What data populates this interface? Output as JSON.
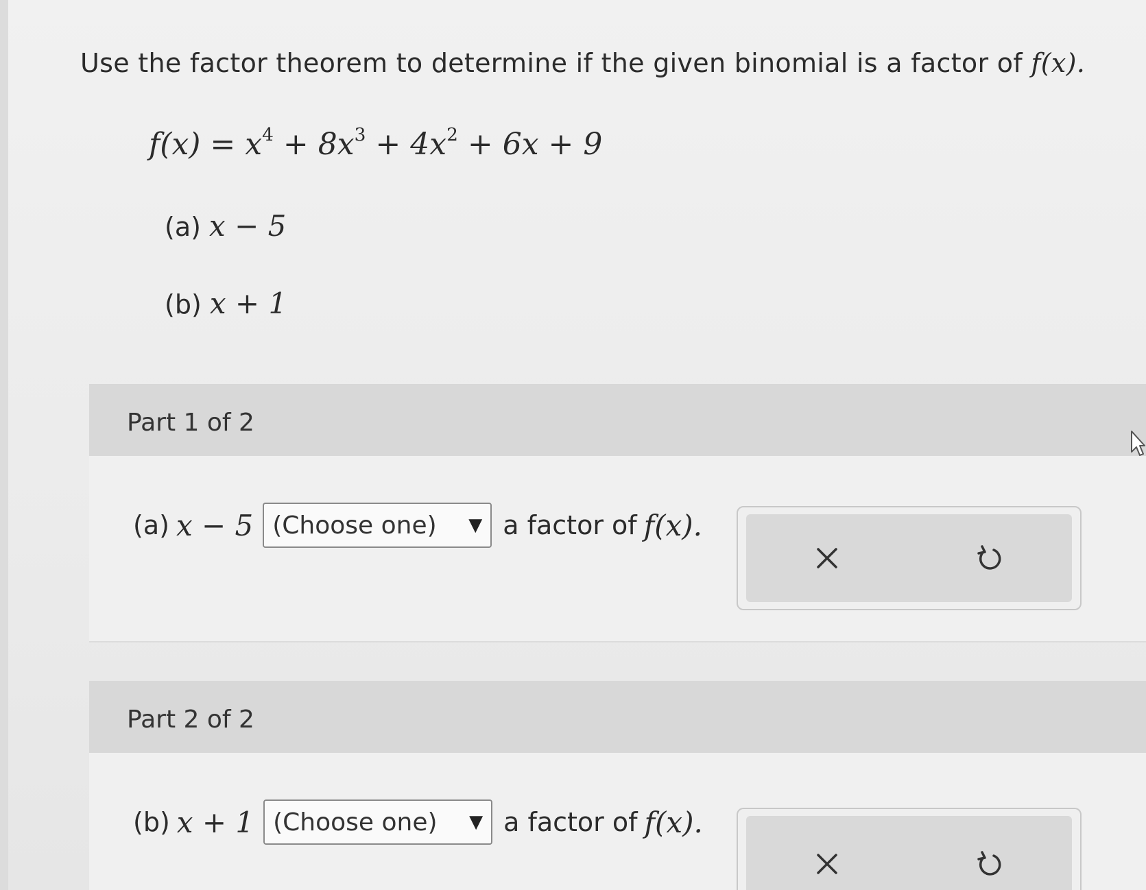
{
  "question": {
    "prompt": "Use the factor theorem to determine if the given binomial is a factor of",
    "prompt_fx": "f(x).",
    "function_lhs": "f(x) =",
    "function_rhs_terms": [
      "x",
      "4",
      "+ 8x",
      "3",
      "+ 4x",
      "2",
      "+ 6x + 9"
    ],
    "item_a_label": "(a)",
    "item_a_expr": "x − 5",
    "item_b_label": "(b)",
    "item_b_expr": "x + 1"
  },
  "parts": [
    {
      "header": "Part 1 of 2",
      "label": "(a)",
      "expr": "x − 5",
      "select_value": "(Choose one)",
      "suffix": "a factor of",
      "suffix_fx": "f(x).",
      "clear_icon": "close-icon",
      "reset_icon": "undo-icon"
    },
    {
      "header": "Part 2 of 2",
      "label": "(b)",
      "expr": "x + 1",
      "select_value": "(Choose one)",
      "suffix": "a factor of",
      "suffix_fx": "f(x).",
      "clear_icon": "close-icon",
      "reset_icon": "undo-icon"
    }
  ],
  "colors": {
    "header_bg": "#d8d8d8",
    "body_bg": "#f0f0f0",
    "text": "#2b2b2b"
  }
}
